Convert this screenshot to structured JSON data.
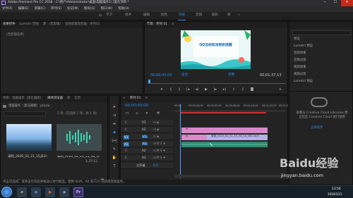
{
  "window": {
    "title": "Adobe Premiere Pro CC 2018 - C:\\用户\\Administrator\\桌面\\电脑操作1\\ [复在项目 *"
  },
  "menu": [
    "文件(F)",
    "编辑(E)",
    "剪辑(C)",
    "序列(S)",
    "标记(M)",
    "图形(G)",
    "窗口(W)",
    "帮助(H)"
  ],
  "workspaces": [
    "学习",
    "组件",
    "编辑",
    "颜色",
    "效果",
    "音频",
    "图形",
    "库"
  ],
  "active_workspace": "效果",
  "source_panel": {
    "tabs": [
      "效果控件",
      "Lumetri 范围",
      "源：(无剪辑)",
      "音频剪辑混合器：序列01"
    ],
    "message": "(无剪辑选择)"
  },
  "program_panel": {
    "tab": "节目：序列 01",
    "title_card_text": "QQ怎样取消更新提醒",
    "timecode_start": "00;00;00;00",
    "fit_label": "适合",
    "quality_label": "完整",
    "timecode_end": "00;01;37;13"
  },
  "effects_panel": {
    "items": [
      "预设",
      "Lumetri 预设",
      "音频效果",
      "音频过渡",
      "视频效果",
      "视频过渡",
      "Lumetri 预设"
    ]
  },
  "project_panel": {
    "tabs": [
      "项目：电脑操作（库在器图）",
      "媒体浏览器",
      "库",
      "信息"
    ],
    "bin_label": "电脑操作（复法器图）.prproj",
    "items_count": "2 项（已选择 1 项，共 1 项）",
    "clip1_name": "录制_2020_02_21_15_3..",
    "clip1_duration": "4:30",
    "clip2_name": "录制_2020_02_21_15_36_14_384.mp3",
    "clip2_duration": "1:37:13"
  },
  "timeline": {
    "tab": "序列 01",
    "timecode": "00;00;00;00",
    "ruler_labels": [
      "00;00",
      "00;00;16;00",
      "00;00;32;00",
      "00;00;48;00",
      "00;01;04;02",
      "00;01;20;02",
      "00;01;3"
    ],
    "tracks": [
      "V3",
      "V2",
      "V1",
      "A1",
      "A2",
      "A3",
      "主声道"
    ],
    "master_value": "0.0",
    "audio_clip_label": "录制_2020_02_21_15_36_14_384.mp3"
  },
  "cc_panel": {
    "message": "查看与 Creative Cloud Libraries 建立社区 Creative Cloud 进行链接",
    "button": "立即同步"
  },
  "status_bar": {
    "text": "单击可选择，或单击空白处并拖动以进行框选。使用 Shift、Alt 和 Ctrl 可获得其他选项。"
  },
  "taskbar": {
    "time": "13:56",
    "date": "2020/5/21"
  },
  "watermark": {
    "text": "Baidu经验",
    "url": "jingyan.baidu.com"
  },
  "colors": {
    "accent": "#2d8ceb",
    "clip_pink": "#d889c9",
    "clip_teal": "#2d8c72",
    "playhead": "#4aa3ff"
  }
}
